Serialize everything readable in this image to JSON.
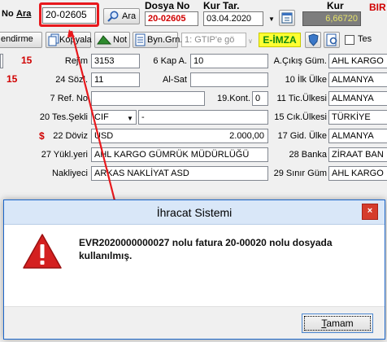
{
  "header": {
    "no_label": "No",
    "ara_label": "Ara",
    "no_value": "20-02605",
    "ara_button": "Ara",
    "dosya_no_label": "Dosya No",
    "dosya_no_value": "20-02605",
    "kur_tar_label": "Kur Tar.",
    "kur_tar_value": "03.04.2020",
    "kur_label": "Kur",
    "kur_value": "6,66720",
    "bir_label": "BIR"
  },
  "toolbar": {
    "edirme_label": "endirme",
    "kopyala_label": "Kopyala",
    "not_label": "Not",
    "byn_grn_label": "Byn.Grn.",
    "gtip_placeholder": "1: GTIP'e gö",
    "eimza_label": "E-İMZA",
    "tes_label": "Tes"
  },
  "form": {
    "left_col": [
      "15",
      "15"
    ],
    "rows": {
      "rejim_label": "Rejim",
      "rejim": "3153",
      "kap_label": "6 Kap A.",
      "kap": "10",
      "cikis_label": "A.Çıkış Güm.",
      "cikis": "AHL KARGO",
      "sozl_label": "24 Sözl.",
      "sozl": "11",
      "alsat_label": "Al-Sat",
      "ilk_ulke_label": "10 İlk Ülke",
      "ilk_ulke": "ALMANYA",
      "ref_label": "7 Ref. No",
      "kont_label": "19.Kont.",
      "kont": "0",
      "tic_label": "11 Tic.Ülkesi",
      "tic": "ALMANYA",
      "tes_sekli_label": "20 Tes.Şekli",
      "tes_sekli": "CIF",
      "tes_sekli_extra": "-",
      "cik_label": "15 Cık.Ülkesi",
      "cik": "TÜRKİYE",
      "doviz_label": "22 Döviz",
      "doviz": "USD",
      "doviz_amount": "2.000,00",
      "gid_label": "17 Gid. Ülke",
      "gid": "ALMANYA",
      "yukl_label": "27 Yükl.yeri",
      "yukl": "AHL KARGO GÜMRÜK MÜDÜRLÜĞÜ",
      "banka_label": "28 Banka",
      "banka": "ZİRAAT BAN",
      "nakliyeci_label": "Nakliyeci",
      "nakliyeci": "ARKAS NAKLİYAT ASD",
      "sinir_label": "29 Sınır Güm",
      "sinir": "AHL KARGO"
    }
  },
  "dialog": {
    "title": "İhracat Sistemi",
    "close_symbol": "×",
    "message": "EVR2020000000027 nolu fatura 20-00020 nolu dosyada kullanılmış.",
    "ok_label": "Tamam",
    "ok_accel": "T",
    "ok_rest": "amam"
  },
  "colors": {
    "highlight_box": "#e8191d",
    "warning_triangle": "#d42020",
    "eimza_bg": "#ffff33",
    "eimza_text": "#118811",
    "kur_bg": "#7d7d7d",
    "kur_text": "#e6e36a"
  }
}
